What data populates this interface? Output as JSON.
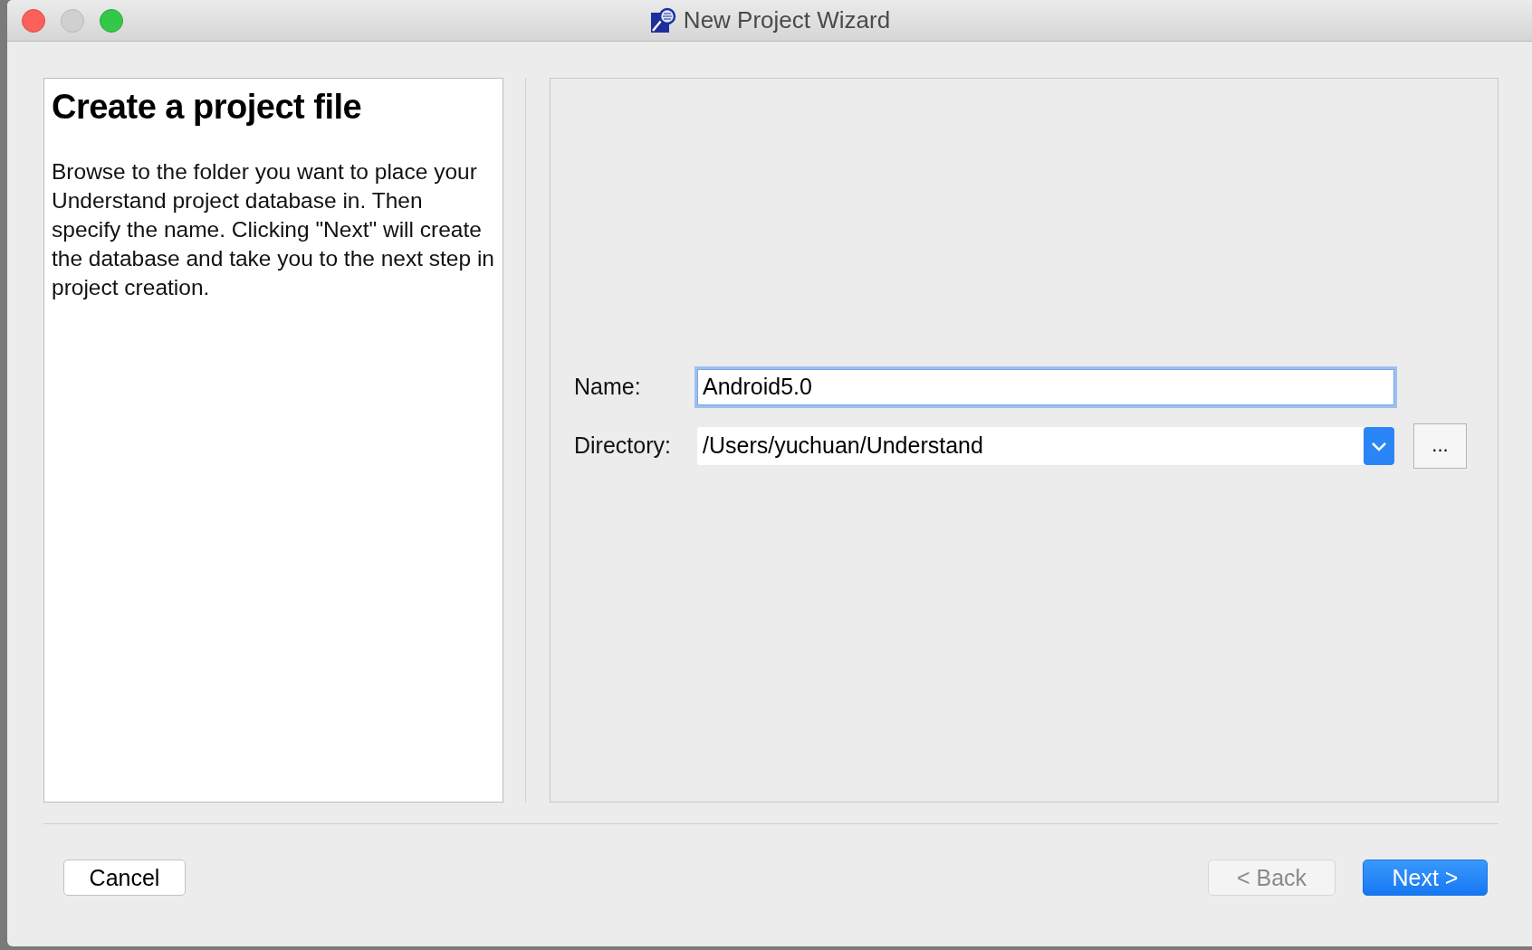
{
  "window": {
    "title": "New Project Wizard"
  },
  "info_panel": {
    "heading": "Create a project file",
    "description": "Browse to the folder you want to place your Understand project database in. Then specify the name. Clicking \"Next\" will create the database and take you to the next step in project creation."
  },
  "form": {
    "fields": [
      {
        "label": "Name:",
        "value": "Android5.0",
        "kind": "text",
        "focused": true
      },
      {
        "label": "Directory:",
        "value": "/Users/yuchuan/Understand",
        "kind": "combo",
        "focused": false,
        "browse_label": "..."
      }
    ]
  },
  "buttons": [
    {
      "label": "Cancel",
      "kind": "secondary",
      "disabled": false
    },
    {
      "label": "< Back",
      "kind": "secondary",
      "disabled": true
    },
    {
      "label": "Next >",
      "kind": "primary",
      "disabled": false
    }
  ]
}
